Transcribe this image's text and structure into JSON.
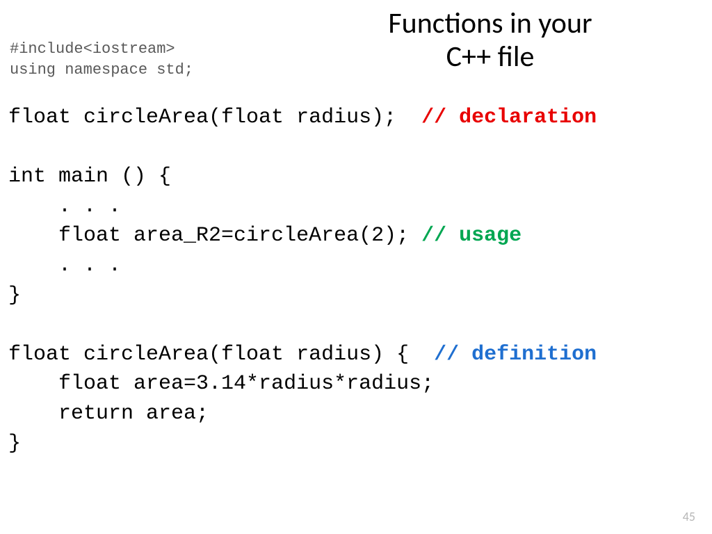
{
  "title_line1": "Functions in your",
  "title_line2": "C++ file",
  "preamble_line1": "#include<iostream>",
  "preamble_line2": "using namespace std;",
  "code": {
    "l1a": "float circleArea(float radius);  ",
    "l1b": "// declaration",
    "l2": "",
    "l3": "int main () {",
    "l4": "    . . .",
    "l5a": "    float area_R2=circleArea(2); ",
    "l5b": "// usage",
    "l6": "    . . .",
    "l7": "}",
    "l8": "",
    "l9a": "float circleArea(float radius) {  ",
    "l9b": "// definition",
    "l10": "    float area=3.14*radius*radius;",
    "l11": "    return area;",
    "l12": "}"
  },
  "page_number": "45"
}
